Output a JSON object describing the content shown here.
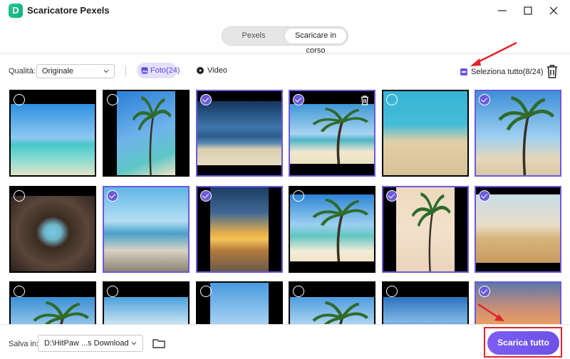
{
  "app": {
    "logo_letter": "D",
    "title": "Scaricatore Pexels"
  },
  "mode_tabs": [
    {
      "label": "Pexels"
    },
    {
      "label": "Scaricare in corso"
    }
  ],
  "toolbar": {
    "quality_label": "Qualità:",
    "quality_value": "Originale",
    "foto_filter": "Foto(24)",
    "video_filter": "Video",
    "select_all": "Seleziona tutto(8/24)"
  },
  "footer": {
    "save_label": "Salva in:",
    "save_path": "D:\\HitPaw ...s Download",
    "download_all": "Scarica tutto"
  },
  "colors": {
    "accent": "#6c5ad9",
    "annotation_red": "#e0242a",
    "logo_green": "#1fb889"
  },
  "grid": {
    "items": [
      {
        "scene": "tropical-beach",
        "selected": false
      },
      {
        "scene": "palm-tree",
        "selected": false
      },
      {
        "scene": "sea-horizon",
        "selected": true
      },
      {
        "scene": "beach-palms",
        "selected": true,
        "delete_icon": true
      },
      {
        "scene": "woman-hat-beach",
        "selected": false
      },
      {
        "scene": "beach-swing",
        "selected": true
      },
      {
        "scene": "sea-cave",
        "selected": false
      },
      {
        "scene": "rocky-shore",
        "selected": true
      },
      {
        "scene": "sunset-sea",
        "selected": true
      },
      {
        "scene": "island-palms",
        "selected": false
      },
      {
        "scene": "desert-palms",
        "selected": true
      },
      {
        "scene": "dune-grass",
        "selected": true
      },
      {
        "scene": "palm-leaves",
        "selected": false
      },
      {
        "scene": "mountain-lake",
        "selected": false
      },
      {
        "scene": "beach-umbrella",
        "selected": false
      },
      {
        "scene": "palm-sky",
        "selected": false
      },
      {
        "scene": "pier-sea",
        "selected": false
      },
      {
        "scene": "orange-sunset",
        "selected": true
      }
    ]
  }
}
